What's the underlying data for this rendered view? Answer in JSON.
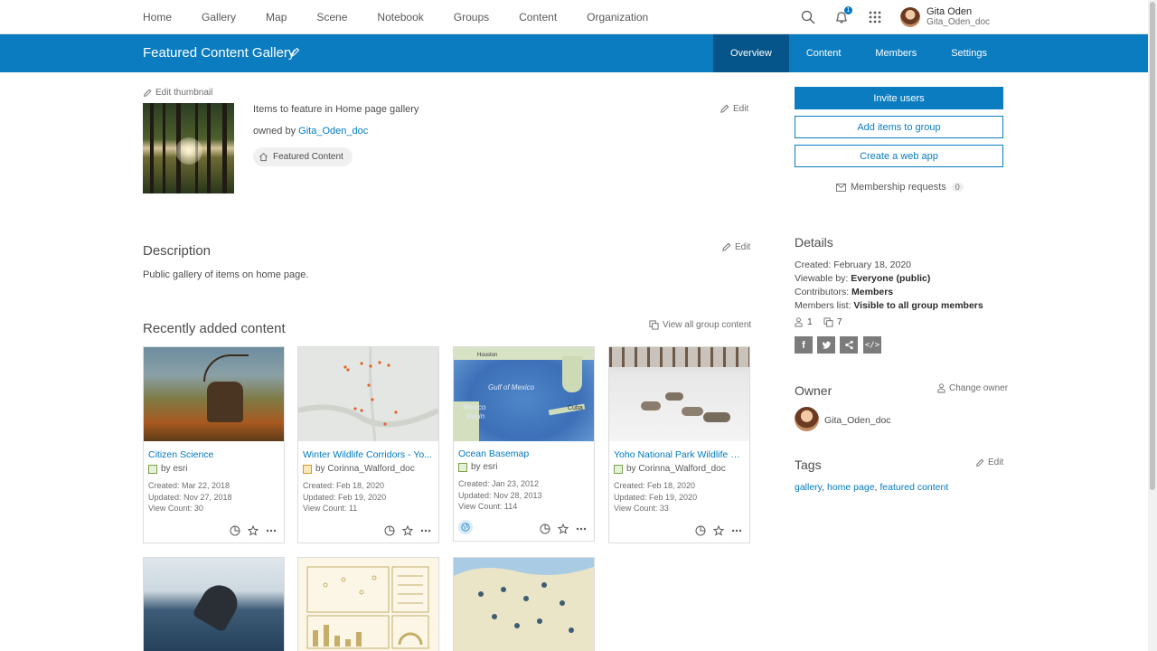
{
  "nav": {
    "links": [
      "Home",
      "Gallery",
      "Map",
      "Scene",
      "Notebook",
      "Groups",
      "Content",
      "Organization"
    ],
    "notification_count": "1",
    "user": {
      "name": "Gita Oden",
      "username": "Gita_Oden_doc"
    }
  },
  "group": {
    "title": "Featured Content Gallery",
    "tabs": [
      "Overview",
      "Content",
      "Members",
      "Settings"
    ],
    "active_tab": "Overview",
    "edit_thumbnail": "Edit thumbnail",
    "summary": "Items to feature in Home page gallery",
    "owned_by_label": "owned by",
    "owner": "Gita_Oden_doc",
    "featured_chip": "Featured Content",
    "edit_label": "Edit"
  },
  "description": {
    "heading": "Description",
    "text": "Public gallery of items on home page.",
    "edit_label": "Edit"
  },
  "recent": {
    "heading": "Recently added content",
    "view_all": "View all group content",
    "items": [
      {
        "title": "Citizen Science",
        "by": "by esri",
        "created": "Created: Mar 22, 2018",
        "updated": "Updated: Nov 27, 2018",
        "views": "View Count: 30"
      },
      {
        "title": "Winter Wildlife Corridors - Yo...",
        "by": "by Corinna_Walford_doc",
        "created": "Created: Feb 18, 2020",
        "updated": "Updated: Feb 19, 2020",
        "views": "View Count: 11"
      },
      {
        "title": "Ocean Basemap",
        "by": "by esri",
        "created": "Created: Jan 23, 2012",
        "updated": "Updated: Nov 28, 2013",
        "views": "View Count: 114"
      },
      {
        "title": "Yoho National Park Wildlife M...",
        "by": "by Corinna_Walford_doc",
        "created": "Created: Feb 18, 2020",
        "updated": "Updated: Feb 19, 2020",
        "views": "View Count: 33"
      }
    ],
    "map_labels": {
      "gulf": "Gulf of Mexico",
      "mexico": "Mexico",
      "basin": "Basin",
      "cuba": "Cuba",
      "houston": "Houston"
    }
  },
  "actions": {
    "invite": "Invite users",
    "add_items": "Add items to group",
    "create_app": "Create a web app",
    "membership_requests": "Membership requests",
    "membership_count": "0"
  },
  "details": {
    "heading": "Details",
    "created": "Created: February 18, 2020",
    "viewable_label": "Viewable by:",
    "viewable_value": "Everyone (public)",
    "contributors_label": "Contributors:",
    "contributors_value": "Members",
    "members_list_label": "Members list:",
    "members_list_value": "Visible to all group members",
    "member_count": "1",
    "item_count": "7"
  },
  "owner": {
    "heading": "Owner",
    "change_owner": "Change owner",
    "name": "Gita_Oden_doc"
  },
  "tags": {
    "heading": "Tags",
    "edit_label": "Edit",
    "list": [
      "gallery",
      "home page",
      "featured content"
    ]
  },
  "colors": {
    "brand": "#0b7cc0",
    "brand_dark": "#06558a",
    "link": "#007ac2"
  }
}
